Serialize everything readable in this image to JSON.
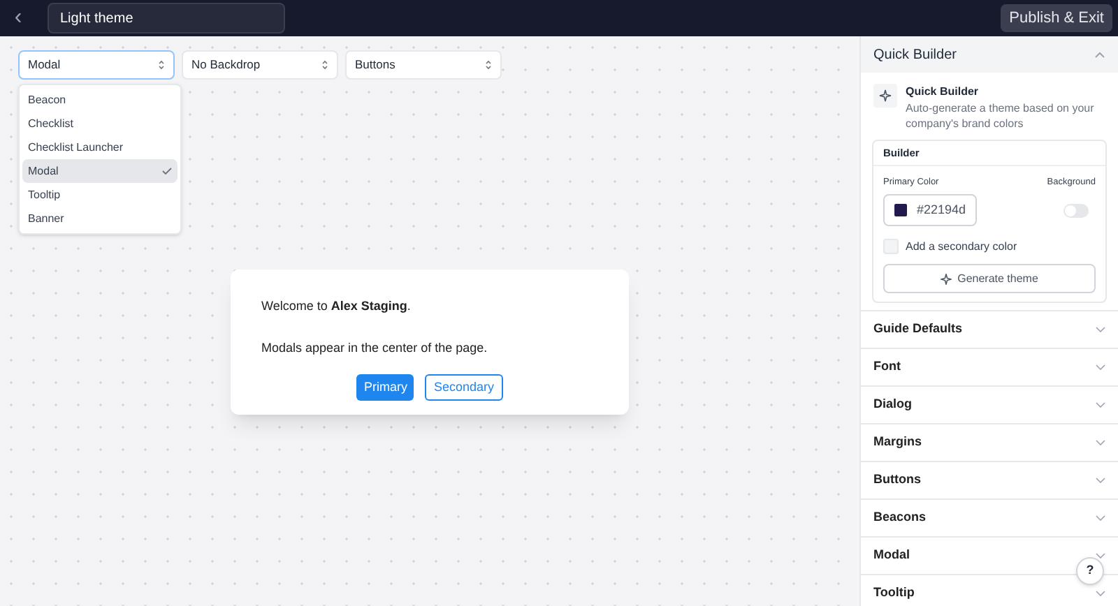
{
  "topbar": {
    "back_icon": "‹",
    "title_value": "Light theme",
    "publish_button": "Publish & Exit"
  },
  "selects": [
    {
      "value": "Modal",
      "open": true
    },
    {
      "value": "No Backdrop",
      "open": false
    },
    {
      "value": "Buttons",
      "open": false
    }
  ],
  "dropdown_options": [
    {
      "label": "Beacon",
      "selected": false
    },
    {
      "label": "Checklist",
      "selected": false
    },
    {
      "label": "Checklist Launcher",
      "selected": false
    },
    {
      "label": "Modal",
      "selected": true
    },
    {
      "label": "Tooltip",
      "selected": false
    },
    {
      "label": "Banner",
      "selected": false
    }
  ],
  "modal": {
    "welcome": "Welcome to **Alex Staging**.",
    "body": "Modals appear in the center of the page.",
    "buttons": [
      {
        "label": "Primary",
        "kind": "primary"
      },
      {
        "label": "Secondary",
        "kind": "secondary"
      }
    ]
  },
  "panel": {
    "quick_builder": {
      "title": "Quick Builder",
      "expanded": true,
      "intro_title": "Quick Builder",
      "intro_text": "Auto-generate a theme based on your company's brand colors",
      "builder_title": "Builder",
      "primary_color_label": "Primary Color",
      "primary_color": {
        "value": "#22194d",
        "color": "#22194d"
      },
      "background_label": "Background",
      "background_on": false,
      "secondary_label": "Add a secondary color",
      "secondary_checked": false,
      "generate_button": "Generate theme"
    },
    "sections": [
      {
        "title": "Guide Defaults",
        "expanded": false
      },
      {
        "title": "Font",
        "expanded": false
      },
      {
        "title": "Dialog",
        "expanded": false
      },
      {
        "title": "Margins",
        "expanded": false
      },
      {
        "title": "Buttons",
        "expanded": false
      },
      {
        "title": "Beacons",
        "expanded": false
      },
      {
        "title": "Modal",
        "expanded": false
      },
      {
        "title": "Tooltip",
        "expanded": false
      }
    ]
  },
  "help_button": "?"
}
